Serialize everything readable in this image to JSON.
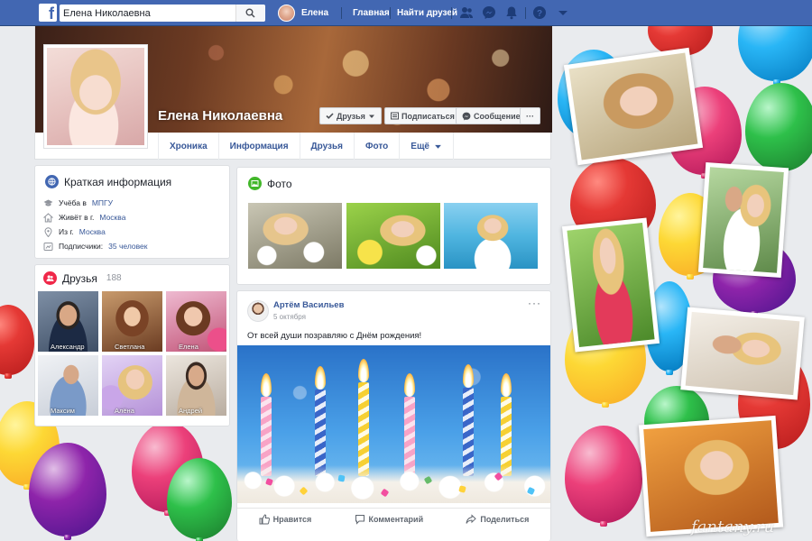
{
  "topbar": {
    "search_value": "Елена Николаевна",
    "user_name": "Елена",
    "links": [
      "Главная",
      "Найти друзей"
    ],
    "icons": [
      "friend-requests-icon",
      "messenger-icon",
      "notifications-icon",
      "help-icon",
      "menu-caret-icon"
    ]
  },
  "profile": {
    "name": "Елена Николаевна",
    "buttons": {
      "friends": "Друзья",
      "follow": "Подписаться",
      "message": "Сообщение",
      "more": "···"
    },
    "tabs": [
      "Хроника",
      "Информация",
      "Друзья",
      "Фото",
      "Ещё"
    ]
  },
  "intro": {
    "title": "Краткая информация",
    "rows": [
      {
        "icon": "school-icon",
        "text": "Учёба в",
        "link": "МПГУ"
      },
      {
        "icon": "home-icon",
        "text": "Живёт в г.",
        "link": "Москва"
      },
      {
        "icon": "location-pin-icon",
        "text": "Из г.",
        "link": "Москва"
      },
      {
        "icon": "followers-icon",
        "text": "Подписчики:",
        "link": "35 человек"
      }
    ]
  },
  "friends": {
    "title": "Друзья",
    "count": "188",
    "items": [
      {
        "name": "Александр"
      },
      {
        "name": "Светлана"
      },
      {
        "name": "Елена"
      },
      {
        "name": "Максим"
      },
      {
        "name": "Алёна"
      },
      {
        "name": "Андрей"
      }
    ]
  },
  "photos": {
    "title": "Фото"
  },
  "post": {
    "author": "Артём Васильев",
    "date": "5 октября",
    "text": "От всей души позравляю с Днём рождения!",
    "actions": {
      "like": "Нравится",
      "comment": "Комментарий",
      "share": "Поделиться"
    }
  },
  "watermark": "fantany.ru",
  "colors": {
    "topbar": "#4267b2",
    "link": "#385898",
    "background": "#e9ebee"
  }
}
